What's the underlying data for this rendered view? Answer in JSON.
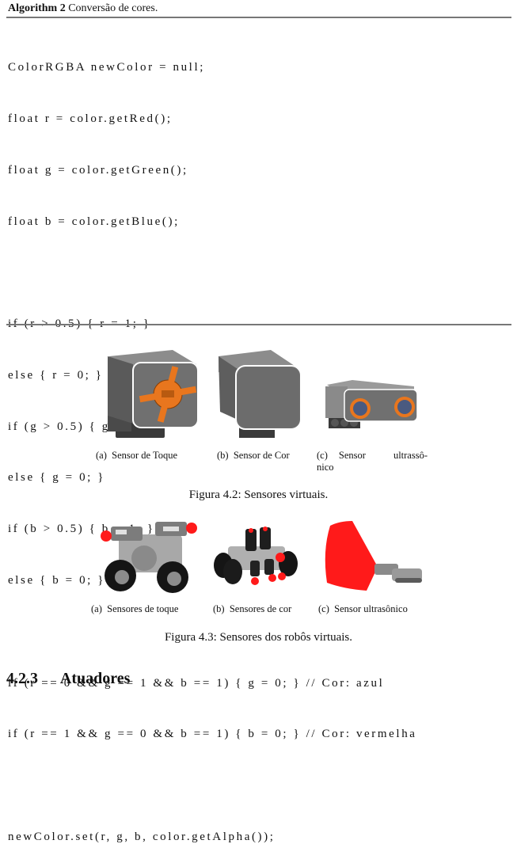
{
  "algorithm": {
    "label": "Algorithm 2",
    "title": "Conversão de cores.",
    "code_lines": [
      "ColorRGBA newColor = null;",
      "float r = color.getRed();",
      "float g = color.getGreen();",
      "float b = color.getBlue();",
      "",
      "if (r > 0.5) { r = 1; }",
      "else { r = 0; }",
      "if (g > 0.5) { g = 1; }",
      "else { g = 0; }",
      "if (b > 0.5) { b = 1; }",
      "else { b = 0; }",
      "",
      "if (r == 0 && g == 1 && b == 1) { g = 0; } // Cor: azul",
      "if (r == 1 && g == 0 && b == 1) { b = 0; } // Cor: vermelha",
      "",
      "newColor.set(r, g, b, color.getAlpha());"
    ]
  },
  "figure_4_2": {
    "caption": "Figura 4.2: Sensores virtuais.",
    "subfigures": [
      {
        "label": "(a)",
        "text": "Sensor de Toque",
        "icon": "touch-sensor-image"
      },
      {
        "label": "(b)",
        "text": "Sensor de Cor",
        "icon": "color-sensor-image"
      },
      {
        "label": "(c)",
        "text": "Sensor ultrassô-",
        "text2": "nico",
        "icon": "ultrasonic-sensor-image"
      }
    ]
  },
  "figure_4_3": {
    "caption": "Figura 4.3: Sensores dos robôs virtuais.",
    "subfigures": [
      {
        "label": "(a)",
        "text": "Sensores de toque",
        "icon": "robot-touch-sensors-image"
      },
      {
        "label": "(b)",
        "text": "Sensores de cor",
        "icon": "robot-color-sensors-image"
      },
      {
        "label": "(c)",
        "text": "Sensor ultrasônico",
        "icon": "robot-ultrasonic-sensor-image"
      }
    ]
  },
  "section": {
    "number": "4.2.3",
    "title": "Atuadores"
  },
  "colors": {
    "sensor_orange": "#e8761e",
    "sensor_gray": "#6e6e6e",
    "marker_red": "#ff1a1a"
  }
}
